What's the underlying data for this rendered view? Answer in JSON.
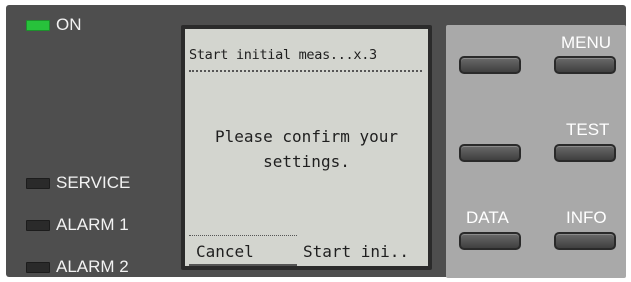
{
  "status_leds": {
    "on": {
      "label": "ON",
      "active": true,
      "color": "#27c23b"
    },
    "service": {
      "label": "SERVICE",
      "active": false
    },
    "alarm1": {
      "label": "ALARM 1",
      "active": false
    },
    "alarm2": {
      "label": "ALARM 2",
      "active": false
    }
  },
  "lcd": {
    "title": "Start initial meas...x.3",
    "message": "Please confirm your\nsettings.",
    "softkey_left": "Cancel",
    "softkey_right": "Start ini.."
  },
  "keypad": {
    "menu_label": "MENU",
    "test_label": "TEST",
    "data_label": "DATA",
    "info_label": "INFO"
  }
}
